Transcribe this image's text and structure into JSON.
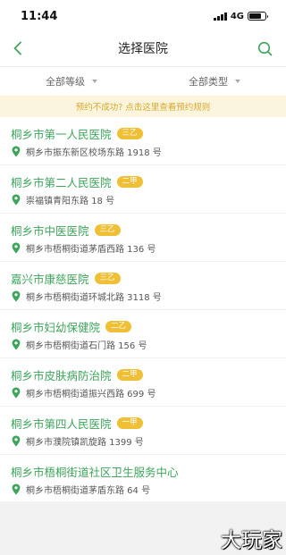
{
  "status_bar": {
    "time": "11:44",
    "network": "4G"
  },
  "nav": {
    "title": "选择医院"
  },
  "filters": {
    "level": "全部等级",
    "type": "全部类型"
  },
  "notice": {
    "text": "预约不成功? 点击这里查看预约规则"
  },
  "hospitals": [
    {
      "name": "桐乡市第一人民医院",
      "badge": "三乙",
      "address": "桐乡市振东新区校场东路 1918 号"
    },
    {
      "name": "桐乡市第二人民医院",
      "badge": "二甲",
      "address": "崇福镇青阳东路 18 号"
    },
    {
      "name": "桐乡市中医医院",
      "badge": "三乙",
      "address": "桐乡市梧桐街道茅盾西路 136 号"
    },
    {
      "name": "嘉兴市康慈医院",
      "badge": "三乙",
      "address": "桐乡市梧桐街道环城北路 3118 号"
    },
    {
      "name": "桐乡市妇幼保健院",
      "badge": "二乙",
      "address": "桐乡市梧桐街道石门路 156 号"
    },
    {
      "name": "桐乡市皮肤病防治院",
      "badge": "二甲",
      "address": "桐乡市梧桐街道振兴西路 699 号"
    },
    {
      "name": "桐乡市第四人民医院",
      "badge": "一甲",
      "address": "桐乡市濮院镇凯旋路 1399 号"
    },
    {
      "name": "桐乡市梧桐街道社区卫生服务中心",
      "badge": "",
      "address": "桐乡市梧桐街道茅盾东路 64 号"
    }
  ],
  "watermark": {
    "text": "大玩家"
  },
  "colors": {
    "accent_green": "#3fa45c",
    "badge_yellow": "#efbf36",
    "notice_bg": "#fbf5dd",
    "notice_text": "#d9a72c"
  }
}
